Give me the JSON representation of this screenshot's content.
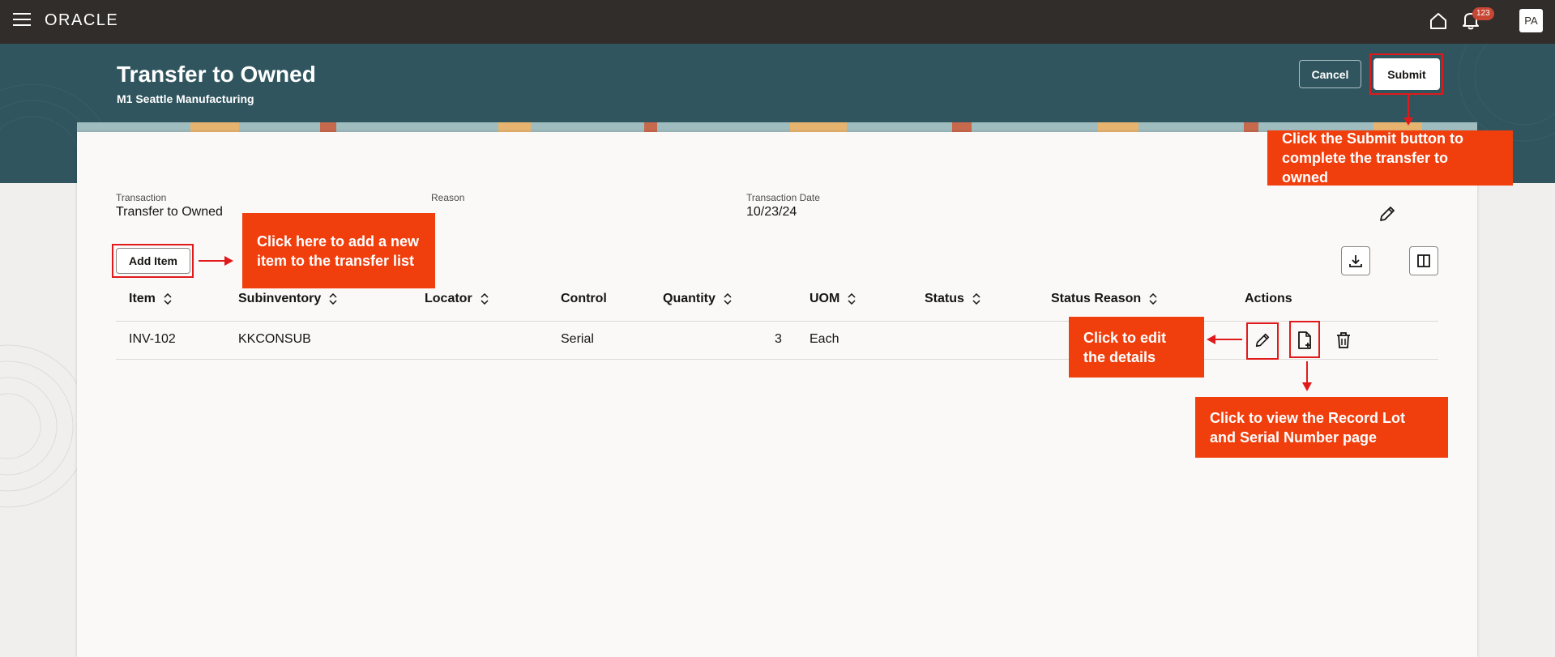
{
  "topbar": {
    "logo": "ORACLE",
    "notification_count": "123",
    "avatar_initials": "PA"
  },
  "header": {
    "title": "Transfer to Owned",
    "subtitle": "M1 Seattle Manufacturing",
    "cancel_label": "Cancel",
    "submit_label": "Submit"
  },
  "details": {
    "transaction_label": "Transaction",
    "transaction_value": "Transfer to Owned",
    "reason_label": "Reason",
    "reason_value": "",
    "date_label": "Transaction Date",
    "date_value": "10/23/24"
  },
  "toolbar": {
    "add_item_label": "Add Item"
  },
  "table": {
    "columns": [
      "Item",
      "Subinventory",
      "Locator",
      "Control",
      "Quantity",
      "UOM",
      "Status",
      "Status Reason",
      "Actions"
    ],
    "rows": [
      {
        "item": "INV-102",
        "subinventory": "KKCONSUB",
        "locator": "",
        "control": "Serial",
        "quantity": "3",
        "uom": "Each",
        "status": "",
        "status_reason": ""
      }
    ]
  },
  "callouts": {
    "submit": "Click the Submit button to complete the transfer to owned",
    "add_item": "Click here to add a new item to the transfer list",
    "edit": "Click to edit the details",
    "record_lot": "Click to view the Record Lot and Serial Number page"
  },
  "colors": {
    "topbar": "#312d2a",
    "header_band": "#30555e",
    "callout": "#f03e0d",
    "highlight": "#e01a1a",
    "badge": "#c74634"
  }
}
